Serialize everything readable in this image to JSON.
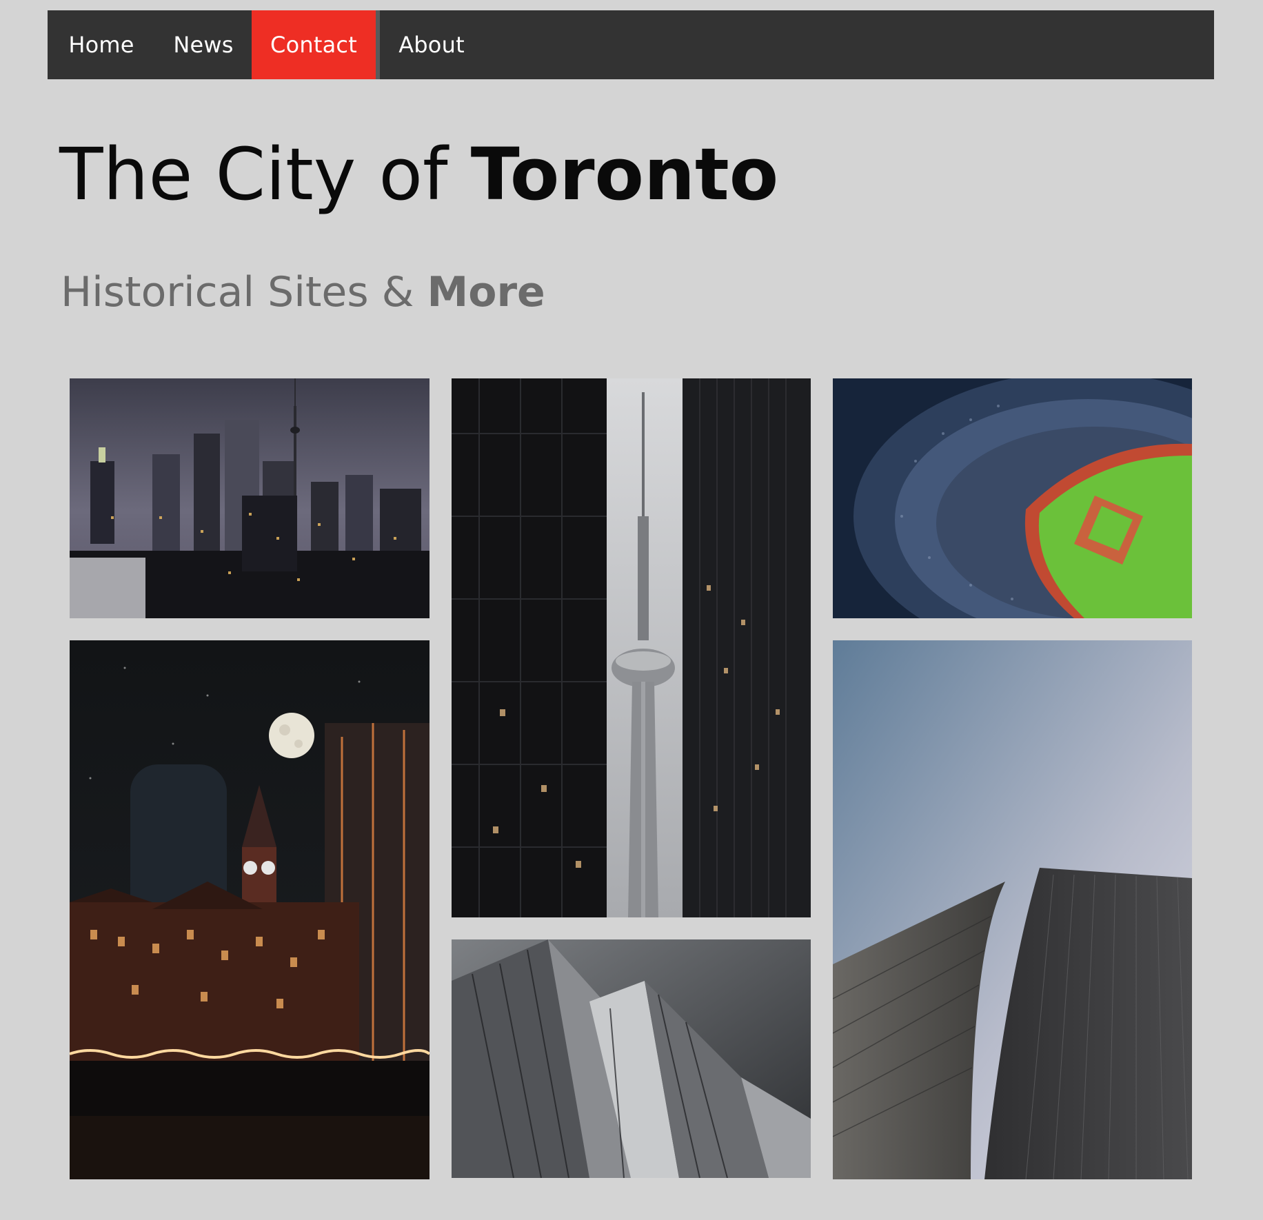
{
  "nav": {
    "items": [
      {
        "label": "Home",
        "active": false
      },
      {
        "label": "News",
        "active": false
      },
      {
        "label": "Contact",
        "active": true
      },
      {
        "label": "About",
        "active": false
      }
    ]
  },
  "header": {
    "title_light": "The City of ",
    "title_bold": "Toronto",
    "subtitle_light": "Historical Sites & ",
    "subtitle_bold": "More"
  },
  "gallery": {
    "images": [
      {
        "subject": "skyline-at-night"
      },
      {
        "subject": "cn-tower-between-skyscrapers"
      },
      {
        "subject": "baseball-stadium-aerial"
      },
      {
        "subject": "old-city-hall-with-moon"
      },
      {
        "subject": "crystal-architecture-building"
      },
      {
        "subject": "skyscrapers-looking-up"
      }
    ]
  },
  "colors": {
    "page_background": "#d4d4d4",
    "nav_background": "#333333",
    "nav_active": "#ee2e24",
    "title_text": "#0a0a0a",
    "subtitle_text": "#6b6b6b"
  }
}
